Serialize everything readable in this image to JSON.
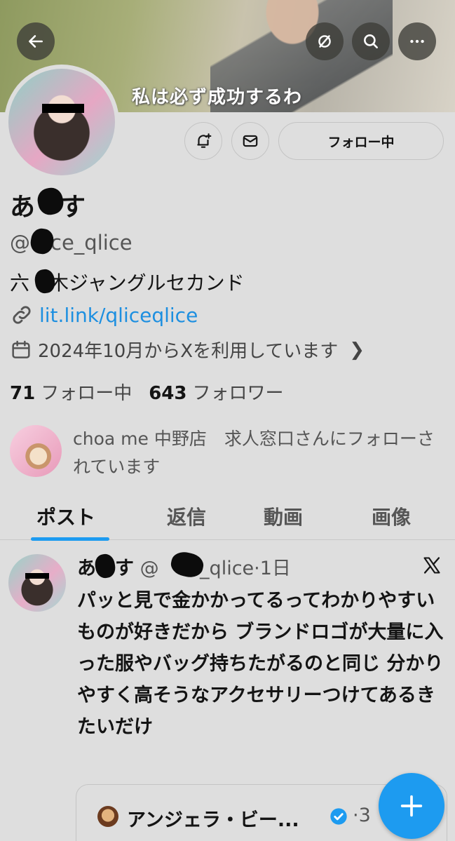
{
  "banner": {
    "caption": "私は必ず成功するわ"
  },
  "actions": {
    "follow_label": "フォロー中"
  },
  "profile": {
    "display_name": "あ　す",
    "handle": "@　ce_qlice",
    "bio": "六　木ジャングルセカンド",
    "link": "lit.link/qliceqlice",
    "joined": "2024年10月からXを利用しています",
    "following_count": "71",
    "following_label": "フォロー中",
    "followers_count": "643",
    "followers_label": "フォロワー",
    "followed_by": "choa me 中野店　求人窓口さんにフォローされています"
  },
  "tabs": [
    {
      "label": "ポスト",
      "active": true
    },
    {
      "label": "返信"
    },
    {
      "label": "動画"
    },
    {
      "label": "画像"
    }
  ],
  "post": {
    "author": "あ　す",
    "meta": "@　ce_qlice·1日",
    "body": "パッと見で金かかってるってわかりやすいものが好きだから ブランドロゴが大量に入った服やバッグ持ちたがるのと同じ 分かりやすく高そうなアクセサリーつけてあるきたいだけ",
    "quote_name": "アンジェラ・ビー...",
    "quote_time": "·3"
  },
  "colors": {
    "accent": "#1d9bf0",
    "background": "#dedede"
  }
}
